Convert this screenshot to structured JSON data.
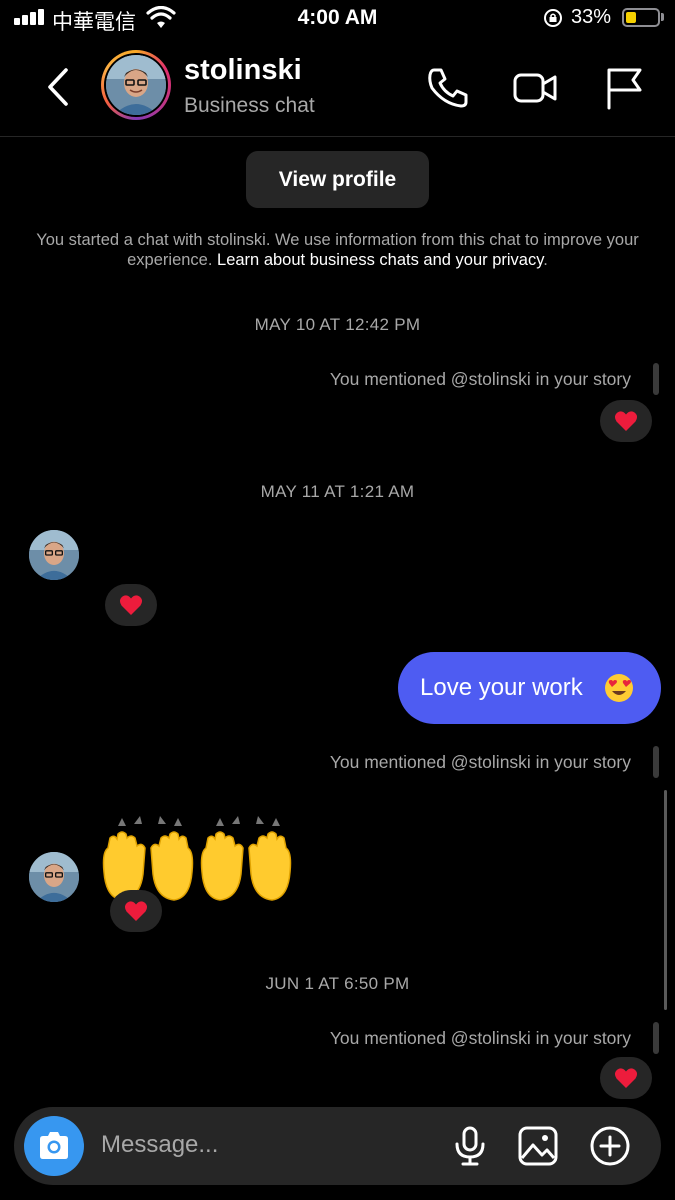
{
  "status_bar": {
    "carrier": "中華電信",
    "time": "4:00 AM",
    "battery": "33%",
    "battery_level": 0.33
  },
  "header": {
    "title": "stolinski",
    "subtitle": "Business chat"
  },
  "chat": {
    "view_profile": "View profile",
    "info_text": "You started a chat with stolinski. We use information from this chat to improve your experience.",
    "info_link": "Learn about business chats and your privacy",
    "info_end": ".",
    "messages": [
      {
        "type": "date",
        "text": "MAY 10 AT 12:42 PM"
      },
      {
        "type": "story_mention",
        "text": "You mentioned @stolinski in your story",
        "reaction": "heart"
      },
      {
        "type": "date",
        "text": "MAY 11 AT 1:21 AM"
      },
      {
        "type": "incoming_reaction",
        "reaction": "heart"
      },
      {
        "type": "outgoing",
        "text": "Love your work",
        "emoji": "heart-eyes-face"
      },
      {
        "type": "story_mention",
        "text": "You mentioned @stolinski in your story"
      },
      {
        "type": "incoming_emoji",
        "emoji": "raising-hands x2",
        "reaction": "heart"
      },
      {
        "type": "date",
        "text": "JUN 1 AT 6:50 PM"
      },
      {
        "type": "story_mention",
        "text": "You mentioned @stolinski in your story",
        "reaction": "heart"
      }
    ]
  },
  "composer": {
    "placeholder": "Message..."
  },
  "colors": {
    "accent": "#3797f0",
    "bubble": "#4e5cf2",
    "surface": "#262626",
    "muted": "#a8a8a8"
  }
}
